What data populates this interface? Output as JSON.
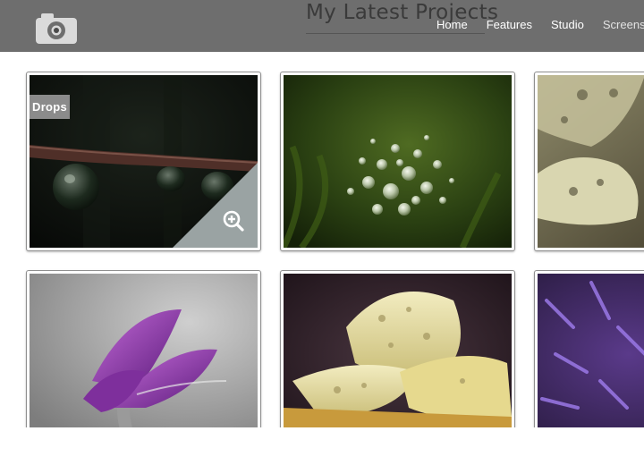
{
  "header": {
    "title": "My Latest Projects",
    "logo_icon": "camera-icon",
    "nav": [
      {
        "label": "Home"
      },
      {
        "label": "Features"
      },
      {
        "label": "Studio"
      },
      {
        "label": "Screenshots"
      }
    ]
  },
  "gallery": {
    "items": [
      {
        "caption": "Drops",
        "subject": "water drops on twig",
        "hover_icon": "zoom-in-icon"
      },
      {
        "caption": "",
        "subject": "dew on green moss"
      },
      {
        "caption": "",
        "subject": "wet cream petals"
      },
      {
        "caption": "",
        "subject": "purple pasque flower"
      },
      {
        "caption": "",
        "subject": "yellow flower with drops"
      },
      {
        "caption": "",
        "subject": "purple thistle"
      }
    ]
  },
  "colors": {
    "header_bg": "#6e6e6e",
    "overlay": "#9aa3a3",
    "caption_bg": "#8b8b8b"
  }
}
